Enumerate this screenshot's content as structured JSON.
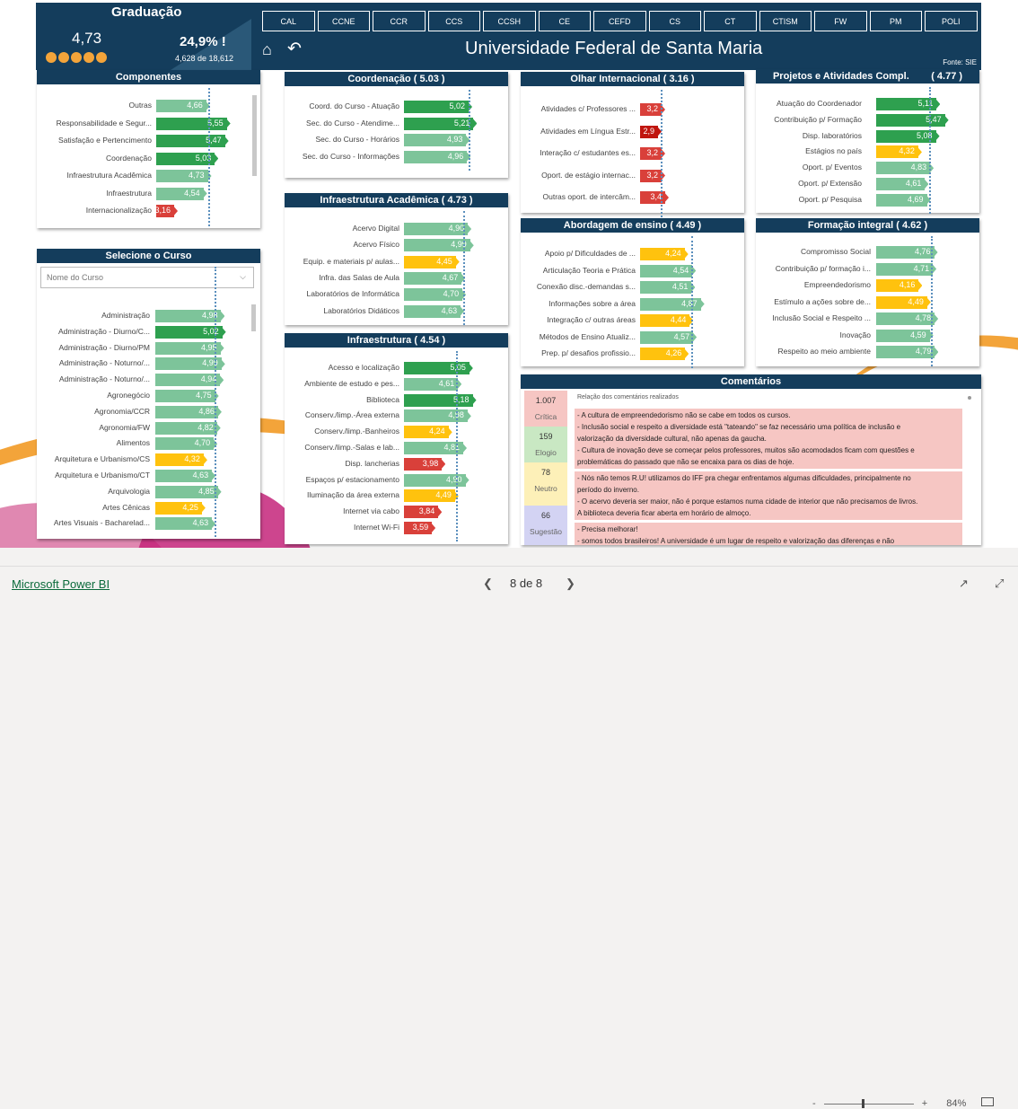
{
  "colors": {
    "navy": "#143d5c",
    "green_dark": "#2ea04f",
    "green_light": "#7dc49a",
    "yellow": "#ffc20e",
    "red": "#d9403a",
    "red_dark": "#c0160f",
    "accent": "#f3a43a"
  },
  "header": {
    "grad_title": "Graduação",
    "grad_value": "4,73",
    "pct": "24,9% !",
    "of_value": "4,628 de 18,612",
    "home_icon": "home-icon",
    "back_icon": "back-arrow-icon",
    "title": "Universidade Federal de Santa Maria",
    "fonte": "Fonte: SIE",
    "rating": 4.73,
    "tabs": [
      "CAL",
      "CCNE",
      "CCR",
      "CCS",
      "CCSH",
      "CE",
      "CEFD",
      "CS",
      "CT",
      "CTISM",
      "FW",
      "PM",
      "POLI"
    ]
  },
  "componentes": {
    "title": "Componentes",
    "rows": [
      {
        "label": "Outras",
        "value": "4,66",
        "c": "l"
      },
      {
        "label": "Responsabilidade e Segur...",
        "value": "5,55",
        "c": "d"
      },
      {
        "label": "Satisfação e Pertencimento",
        "value": "5,47",
        "c": "d"
      },
      {
        "label": "Coordenação",
        "value": "5,03",
        "c": "d"
      },
      {
        "label": "Infraestrutura Acadêmica",
        "value": "4,73",
        "c": "l"
      },
      {
        "label": "Infraestrutura",
        "value": "4,54",
        "c": "l"
      },
      {
        "label": "Internacionalização",
        "value": "3,16",
        "c": "r"
      }
    ]
  },
  "selecione": {
    "title": "Selecione o Curso",
    "placeholder": "Nome do Curso",
    "rows": [
      {
        "label": "Administração",
        "value": "4,98",
        "c": "l"
      },
      {
        "label": "Administração - Diurno/C...",
        "value": "5,02",
        "c": "d"
      },
      {
        "label": "Administração - Diurno/PM",
        "value": "4,95",
        "c": "l"
      },
      {
        "label": "Administração - Noturno/...",
        "value": "4,99",
        "c": "l"
      },
      {
        "label": "Administração - Noturno/...",
        "value": "4,94",
        "c": "l"
      },
      {
        "label": "Agronegócio",
        "value": "4,75",
        "c": "l"
      },
      {
        "label": "Agronomia/CCR",
        "value": "4,86",
        "c": "l"
      },
      {
        "label": "Agronomia/FW",
        "value": "4,82",
        "c": "l"
      },
      {
        "label": "Alimentos",
        "value": "4,70",
        "c": "l"
      },
      {
        "label": "Arquitetura e Urbanismo/CS",
        "value": "4,32",
        "c": "y"
      },
      {
        "label": "Arquitetura e Urbanismo/CT",
        "value": "4,63",
        "c": "l"
      },
      {
        "label": "Arquivologia",
        "value": "4,85",
        "c": "l"
      },
      {
        "label": "Artes Cênicas",
        "value": "4,25",
        "c": "y"
      },
      {
        "label": "Artes Visuais - Bacharelad...",
        "value": "4,63",
        "c": "l"
      }
    ]
  },
  "coordenacao": {
    "title": "Coordenação ( 5.03 )",
    "rows": [
      {
        "label": "Coord. do Curso - Atuação",
        "value": "5,02",
        "c": "d"
      },
      {
        "label": "Sec. do Curso - Atendime...",
        "value": "5,21",
        "c": "d"
      },
      {
        "label": "Sec. do Curso - Horários",
        "value": "4,93",
        "c": "l"
      },
      {
        "label": "Sec. do Curso - Informações",
        "value": "4,96",
        "c": "l"
      }
    ]
  },
  "infra_acad": {
    "title": "Infraestrutura Acadêmica ( 4.73 )",
    "rows": [
      {
        "label": "Acervo Digital",
        "value": "4,90",
        "c": "l"
      },
      {
        "label": "Acervo Físico",
        "value": "4,99",
        "c": "l"
      },
      {
        "label": "Equip. e materiais p/ aulas...",
        "value": "4,45",
        "c": "y"
      },
      {
        "label": "Infra. das Salas de Aula",
        "value": "4,67",
        "c": "l"
      },
      {
        "label": "Laboratórios de Informática",
        "value": "4,70",
        "c": "l"
      },
      {
        "label": "Laboratórios Didáticos",
        "value": "4,63",
        "c": "l"
      }
    ]
  },
  "infra": {
    "title": "Infraestrutura ( 4.54 )",
    "rows": [
      {
        "label": "Acesso e localização",
        "value": "5,05",
        "c": "d"
      },
      {
        "label": "Ambiente de estudo e pes...",
        "value": "4,61",
        "c": "l"
      },
      {
        "label": "Biblioteca",
        "value": "5,18",
        "c": "d"
      },
      {
        "label": "Conserv./limp.-Área externa",
        "value": "4,98",
        "c": "l"
      },
      {
        "label": "Conserv./limp.-Banheiros",
        "value": "4,24",
        "c": "y"
      },
      {
        "label": "Conserv./limp.-Salas e lab...",
        "value": "4,81",
        "c": "l"
      },
      {
        "label": "Disp. lancherias",
        "value": "3,98",
        "c": "r"
      },
      {
        "label": "Espaços p/ estacionamento",
        "value": "4,90",
        "c": "l"
      },
      {
        "label": "Iluminação da área externa",
        "value": "4,49",
        "c": "y"
      },
      {
        "label": "Internet via cabo",
        "value": "3,84",
        "c": "r"
      },
      {
        "label": "Internet Wi-Fi",
        "value": "3,59",
        "c": "r"
      }
    ]
  },
  "olhar": {
    "title": "Olhar Internacional ( 3.16 )",
    "rows": [
      {
        "label": "Atividades c/ Professores ...",
        "value": "3,2",
        "c": "r"
      },
      {
        "label": "Atividades em Língua Estr...",
        "value": "2,9",
        "c": "x"
      },
      {
        "label": "Interação c/ estudantes es...",
        "value": "3,2",
        "c": "r"
      },
      {
        "label": "Oport. de estágio internac...",
        "value": "3,2",
        "c": "r"
      },
      {
        "label": "Outras oport. de intercâm...",
        "value": "3,4",
        "c": "r"
      }
    ]
  },
  "abordagem": {
    "title": "Abordagem de ensino ( 4.49 )",
    "rows": [
      {
        "label": "Apoio p/ Dificuldades de ...",
        "value": "4,24",
        "c": "y"
      },
      {
        "label": "Articulação Teoria e Prática",
        "value": "4,54",
        "c": "l"
      },
      {
        "label": "Conexão disc.-demandas s...",
        "value": "4,51",
        "c": "l"
      },
      {
        "label": "Informações sobre a área",
        "value": "4,87",
        "c": "l"
      },
      {
        "label": "Integração c/ outras áreas",
        "value": "4,44",
        "c": "y"
      },
      {
        "label": "Métodos de Ensino Atualiz...",
        "value": "4,57",
        "c": "l"
      },
      {
        "label": "Prep. p/ desafios profissio...",
        "value": "4,26",
        "c": "y"
      }
    ]
  },
  "projetos": {
    "title": "Projetos e Atividades Compl.        ( 4.77 )",
    "rows": [
      {
        "label": "Atuação do Coordenador",
        "value": "5,11",
        "c": "d"
      },
      {
        "label": "Contribuição p/ Formação",
        "value": "5,47",
        "c": "d"
      },
      {
        "label": "Disp. laboratórios",
        "value": "5,08",
        "c": "d"
      },
      {
        "label": "Estágios no país",
        "value": "4,32",
        "c": "y"
      },
      {
        "label": "Oport. p/ Eventos",
        "value": "4,83",
        "c": "l"
      },
      {
        "label": "Oport. p/ Extensão",
        "value": "4,61",
        "c": "l"
      },
      {
        "label": "Oport. p/ Pesquisa",
        "value": "4,69",
        "c": "l"
      }
    ]
  },
  "formacao": {
    "title": "Formação integral ( 4.62 )",
    "rows": [
      {
        "label": "Compromisso Social",
        "value": "4,76",
        "c": "l"
      },
      {
        "label": "Contribuição p/ formação i...",
        "value": "4,71",
        "c": "l"
      },
      {
        "label": "Empreendedorismo",
        "value": "4,16",
        "c": "y"
      },
      {
        "label": "Estímulo a ações sobre de...",
        "value": "4,49",
        "c": "y"
      },
      {
        "label": "Inclusão Social e Respeito ...",
        "value": "4,78",
        "c": "l"
      },
      {
        "label": "Inovação",
        "value": "4,59",
        "c": "l"
      },
      {
        "label": "Respeito ao meio ambiente",
        "value": "4,79",
        "c": "l"
      }
    ]
  },
  "comentarios": {
    "title": "Comentários",
    "header": "Relação dos comentários realizados",
    "counts": [
      {
        "num": "1.007",
        "cap": "Crítica",
        "bg": "#f6c6c3"
      },
      {
        "num": "159",
        "cap": "Elogio",
        "bg": "#c9e8c3"
      },
      {
        "num": "78",
        "cap": "Neutro",
        "bg": "#fdf0b8"
      },
      {
        "num": "66",
        "cap": "Sugestão",
        "bg": "#d3d3f3"
      }
    ],
    "blocks": [
      {
        "bg": "#f6c6c3",
        "lines": [
          "- A cultura de empreendedorismo não se cabe em todos os cursos.",
          "- Inclusão social e respeito a diversidade está \"tateando\" se faz necessário uma política de inclusão e",
          "valorização da diversidade cultural, não apenas da gaucha.",
          "- Cultura de inovação deve se começar pelos professores, muitos são acomodados ficam com questões e",
          "problemáticas do passado que não se encaixa para os dias de hoje."
        ]
      },
      {
        "bg": "#f6c6c3",
        "lines": [
          "- Nós não temos R.U! utilizamos do IFF pra chegar enfrentamos algumas dificuldades, principalmente no",
          "período do inverno.",
          "- O acervo deveria ser maior, não é porque estamos numa cidade de interior que não precisamos de livros.",
          "A biblioteca deveria ficar aberta em horário de almoço."
        ]
      },
      {
        "bg": "#f6c6c3",
        "lines": [
          "- Precisa melhorar!",
          "- somos todos brasileiros! A universidade é um lugar de respeito e valorização das diferenças e não"
        ]
      }
    ]
  },
  "footer": {
    "brand": "Microsoft Power BI",
    "page": "8 de 8",
    "zoom": "84%",
    "minus": "-",
    "plus": "+",
    "prev_icon": "chevron-left-icon",
    "next_icon": "chevron-right-icon",
    "share_icon": "share-icon",
    "expand_icon": "expand-icon",
    "fit_icon": "fit-page-icon"
  }
}
